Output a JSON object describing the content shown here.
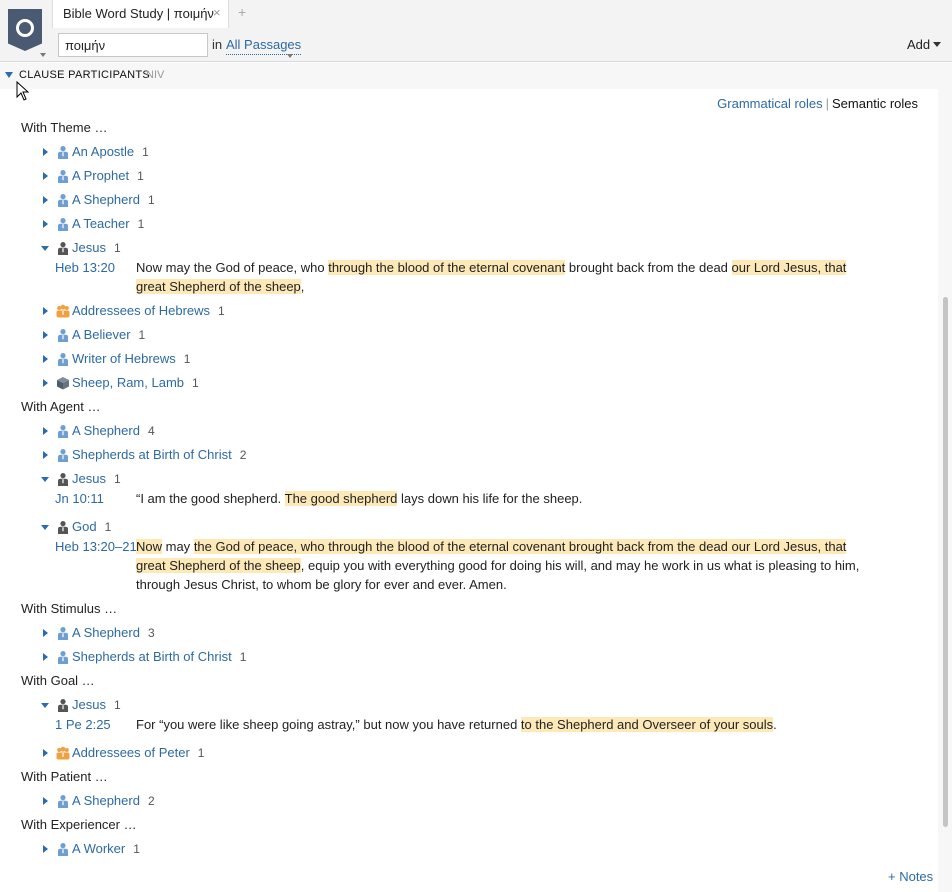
{
  "header": {
    "tab_title": "Bible Word Study | ποιμήν",
    "tab_close": "×",
    "tab_add": "+",
    "search_value": "ποιμήν",
    "in_label": "in",
    "passages_label": "All Passages",
    "add_label": "Add"
  },
  "section": {
    "title": "CLAUSE PARTICIPANTS",
    "version": "NIV",
    "roles": {
      "grammatical": "Grammatical roles",
      "separator": "|",
      "semantic": "Semantic roles"
    }
  },
  "groups": [
    {
      "heading": "With Theme …",
      "items": [
        {
          "label": "An Apostle",
          "count": "1",
          "icon": "person-icon",
          "expanded": false
        },
        {
          "label": "A Prophet",
          "count": "1",
          "icon": "person-icon",
          "expanded": false
        },
        {
          "label": "A Shepherd",
          "count": "1",
          "icon": "person-icon",
          "expanded": false
        },
        {
          "label": "A Teacher",
          "count": "1",
          "icon": "person-icon",
          "expanded": false
        },
        {
          "label": "Jesus",
          "count": "1",
          "icon": "person-dark-icon",
          "expanded": true,
          "ref": "Heb 13:20",
          "verse": [
            {
              "t": "Now may the God of peace, who ",
              "h": false
            },
            {
              "t": "through the blood of the eternal covenant",
              "h": true
            },
            {
              "t": " brought back from the dead ",
              "h": false
            },
            {
              "t": "our Lord Jesus, that great Shepherd of the sheep",
              "h": true
            },
            {
              "t": ",",
              "h": false
            }
          ]
        },
        {
          "label": "Addressees of Hebrews",
          "count": "1",
          "icon": "group-icon",
          "expanded": false
        },
        {
          "label": "A Believer",
          "count": "1",
          "icon": "person-icon",
          "expanded": false
        },
        {
          "label": "Writer of Hebrews",
          "count": "1",
          "icon": "person-icon",
          "expanded": false
        },
        {
          "label": "Sheep, Ram, Lamb",
          "count": "1",
          "icon": "cube-icon",
          "expanded": false
        }
      ]
    },
    {
      "heading": "With Agent …",
      "items": [
        {
          "label": "A Shepherd",
          "count": "4",
          "icon": "person-icon",
          "expanded": false
        },
        {
          "label": "Shepherds at Birth of Christ",
          "count": "2",
          "icon": "person-icon",
          "expanded": false
        },
        {
          "label": "Jesus",
          "count": "1",
          "icon": "person-dark-icon",
          "expanded": true,
          "ref": "Jn 10:11",
          "verse": [
            {
              "t": "“I am the good shepherd. ",
              "h": false
            },
            {
              "t": "The good shepherd",
              "h": true
            },
            {
              "t": " lays down his life for the sheep.",
              "h": false
            }
          ]
        },
        {
          "label": "God",
          "count": "1",
          "icon": "person-dark-icon",
          "expanded": true,
          "ref": "Heb 13:20–21",
          "verse": [
            {
              "t": "Now",
              "h": true
            },
            {
              "t": " may ",
              "h": false
            },
            {
              "t": "the God of peace, who through the blood of the eternal covenant brought back from the dead our Lord Jesus, that great Shepherd of the sheep",
              "h": true
            },
            {
              "t": ", equip you with everything good for doing his will, and may he work in us what is pleasing to him, through Jesus Christ, to whom be glory for ever and ever. Amen.",
              "h": false
            }
          ]
        }
      ]
    },
    {
      "heading": "With Stimulus …",
      "items": [
        {
          "label": "A Shepherd",
          "count": "3",
          "icon": "person-icon",
          "expanded": false
        },
        {
          "label": "Shepherds at Birth of Christ",
          "count": "1",
          "icon": "person-icon",
          "expanded": false
        }
      ]
    },
    {
      "heading": "With Goal …",
      "items": [
        {
          "label": "Jesus",
          "count": "1",
          "icon": "person-dark-icon",
          "expanded": true,
          "ref": "1 Pe 2:25",
          "verse": [
            {
              "t": "For “you were like sheep going astray,” but now you have returned ",
              "h": false
            },
            {
              "t": "to the Shepherd and Overseer of your souls",
              "h": true
            },
            {
              "t": ".",
              "h": false
            }
          ]
        },
        {
          "label": "Addressees of Peter",
          "count": "1",
          "icon": "group-icon",
          "expanded": false
        }
      ]
    },
    {
      "heading": "With Patient …",
      "items": [
        {
          "label": "A Shepherd",
          "count": "2",
          "icon": "person-icon",
          "expanded": false
        }
      ]
    },
    {
      "heading": "With Experiencer …",
      "items": [
        {
          "label": "A Worker",
          "count": "1",
          "icon": "person-icon",
          "expanded": false
        }
      ]
    }
  ],
  "footer": {
    "notes_label": "+ Notes"
  },
  "colors": {
    "link": "#2d6aa3",
    "highlight": "#fde9b7",
    "logo": "#4a5a72",
    "group_icon": "#f0a040"
  }
}
